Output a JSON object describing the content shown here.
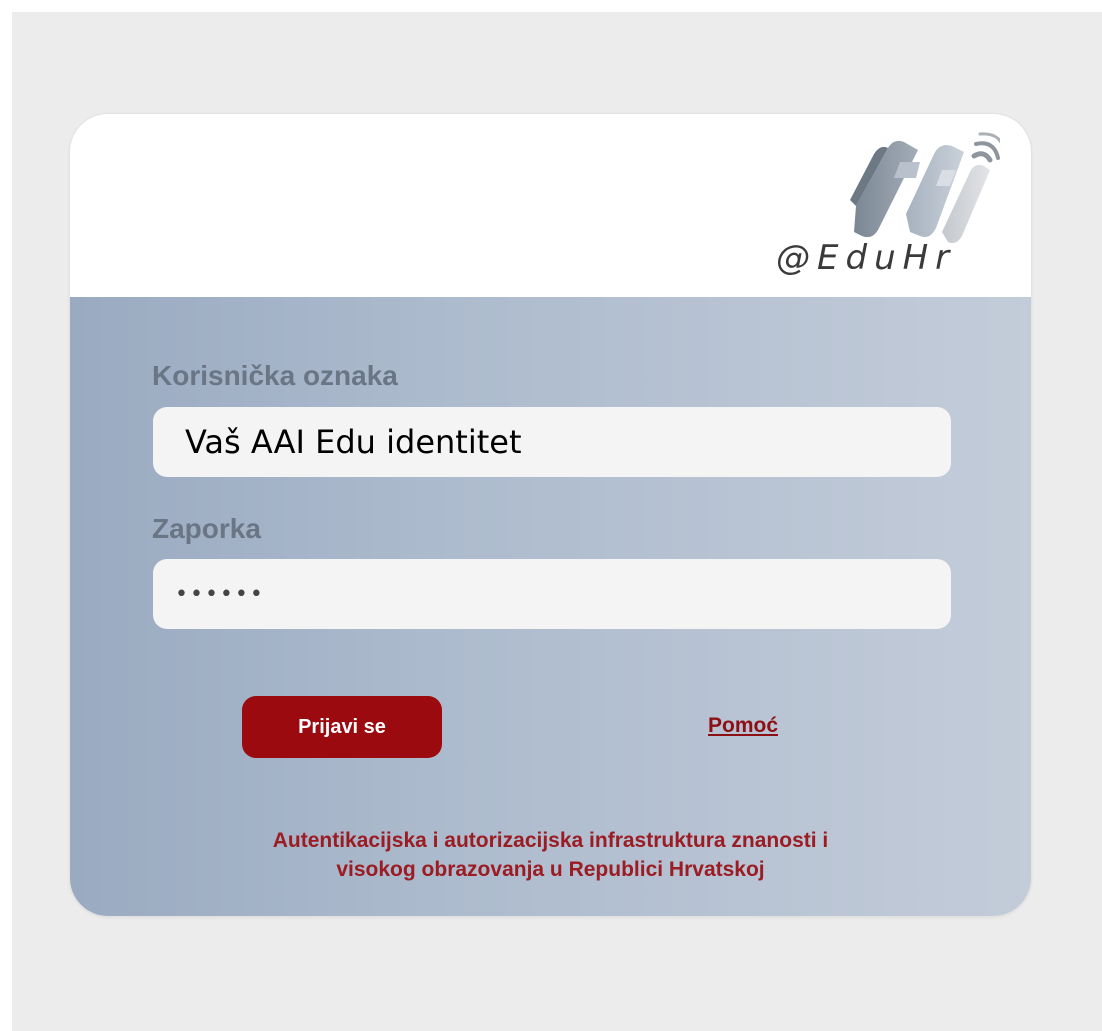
{
  "logo": {
    "text": "@EduHr",
    "icon": "aai-logo-icon"
  },
  "form": {
    "username_label": "Korisnička oznaka",
    "username_value": "Vaš AAI Edu identitet",
    "password_label": "Zaporka",
    "password_value": "••••••",
    "submit_label": "Prijavi se",
    "help_label": "Pomoć"
  },
  "footer": {
    "line1": "Autentikacijska i autorizacijska infrastruktura znanosti i",
    "line2": "visokog obrazovanja u Republici Hrvatskoj"
  },
  "colors": {
    "accent": "#9a0a0f",
    "link": "#8e0f14",
    "panel": "#adbbce",
    "page_background": "#ececec"
  }
}
